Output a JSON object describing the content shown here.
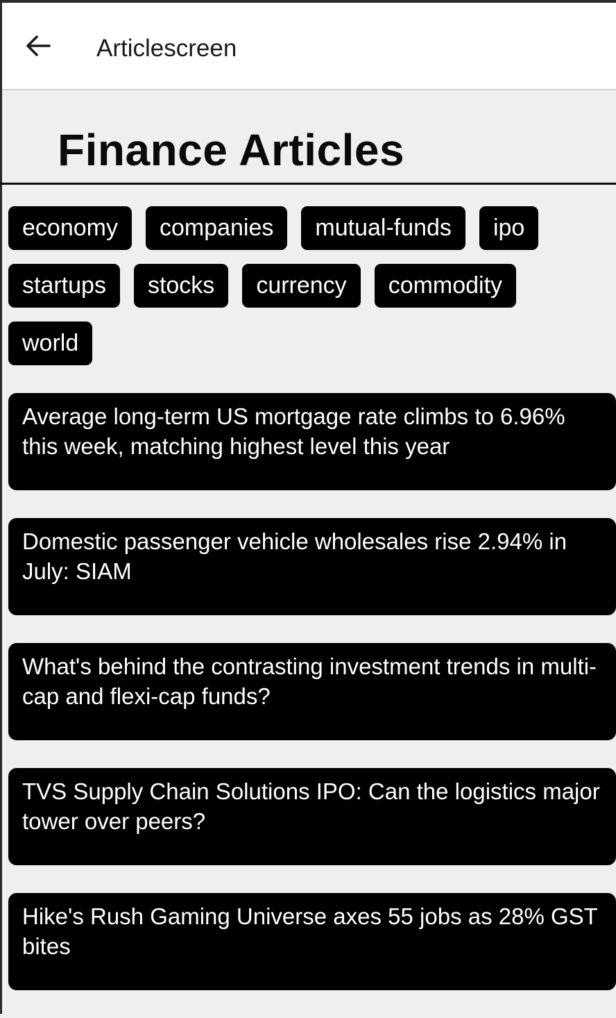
{
  "appbar": {
    "title": "Articlescreen",
    "back_icon": "arrow-left-icon"
  },
  "page": {
    "heading": "Finance Articles"
  },
  "categories": [
    "economy",
    "companies",
    "mutual-funds",
    "ipo",
    "startups",
    "stocks",
    "currency",
    "commodity",
    "world"
  ],
  "articles": [
    {
      "title": "Average long-term US mortgage rate climbs to 6.96% this week, matching highest level this year"
    },
    {
      "title": "Domestic passenger vehicle wholesales rise 2.94% in July: SIAM"
    },
    {
      "title": "What's behind the contrasting investment trends in multi-cap and flexi-cap funds?"
    },
    {
      "title": "TVS Supply Chain Solutions IPO: Can the logistics major tower over peers?"
    },
    {
      "title": "Hike's Rush Gaming Universe axes 55 jobs as 28% GST bites"
    }
  ],
  "colors": {
    "background": "#efefef",
    "appbar": "#ffffff",
    "chip": "#000000",
    "chip_text": "#ffffff"
  }
}
